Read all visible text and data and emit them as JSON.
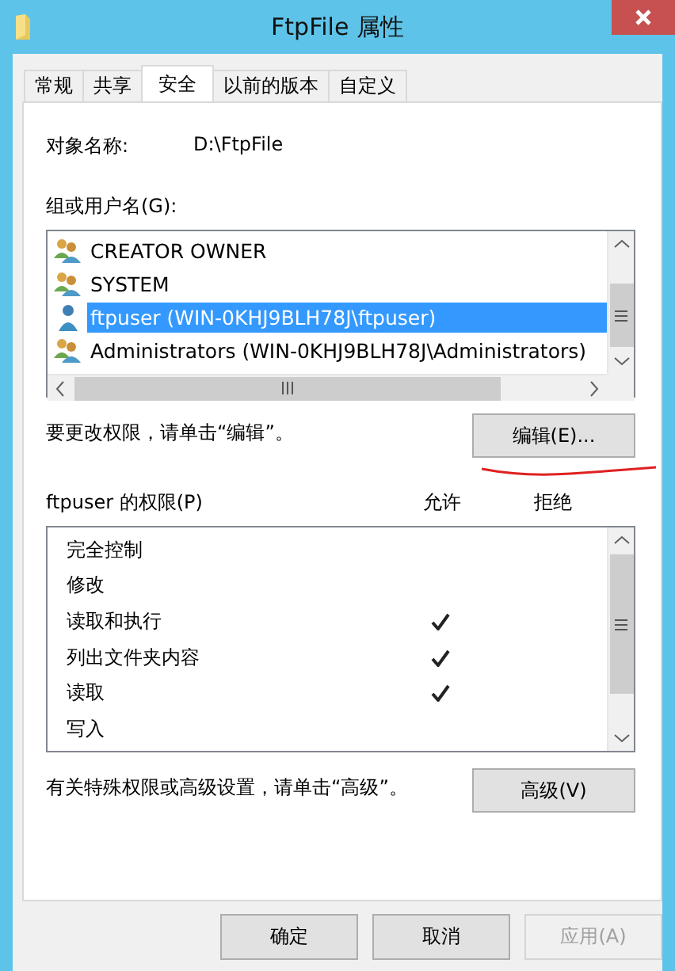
{
  "window": {
    "title": "FtpFile 属性"
  },
  "tabs": [
    {
      "label": "常规",
      "selected": false
    },
    {
      "label": "共享",
      "selected": false
    },
    {
      "label": "安全",
      "selected": true
    },
    {
      "label": "以前的版本",
      "selected": false
    },
    {
      "label": "自定义",
      "selected": false
    }
  ],
  "object_name": {
    "label": "对象名称:",
    "value": "D:\\FtpFile"
  },
  "groups": {
    "label": "组或用户名(G):",
    "items": [
      {
        "kind": "group",
        "name": "CREATOR OWNER",
        "selected": false
      },
      {
        "kind": "group",
        "name": "SYSTEM",
        "selected": false
      },
      {
        "kind": "user",
        "name": "ftpuser (WIN-0KHJ9BLH78J\\ftpuser)",
        "selected": true
      },
      {
        "kind": "group",
        "name": "Administrators (WIN-0KHJ9BLH78J\\Administrators)",
        "selected": false
      }
    ]
  },
  "edit_hint": "要更改权限，请单击“编辑”。",
  "edit_button": "编辑(E)...",
  "permissions": {
    "title": "ftpuser 的权限(P)",
    "columns": [
      "允许",
      "拒绝"
    ],
    "rows": [
      {
        "name": "完全控制",
        "allow": false,
        "deny": false
      },
      {
        "name": "修改",
        "allow": false,
        "deny": false
      },
      {
        "name": "读取和执行",
        "allow": true,
        "deny": false
      },
      {
        "name": "列出文件夹内容",
        "allow": true,
        "deny": false
      },
      {
        "name": "读取",
        "allow": true,
        "deny": false
      },
      {
        "name": "写入",
        "allow": false,
        "deny": false
      }
    ]
  },
  "advanced_hint": "有关特殊权限或高级设置，请单击“高级”。",
  "advanced_button": "高级(V)",
  "buttons": [
    {
      "label": "确定",
      "disabled": false
    },
    {
      "label": "取消",
      "disabled": false
    },
    {
      "label": "应用(A)",
      "disabled": true
    }
  ]
}
